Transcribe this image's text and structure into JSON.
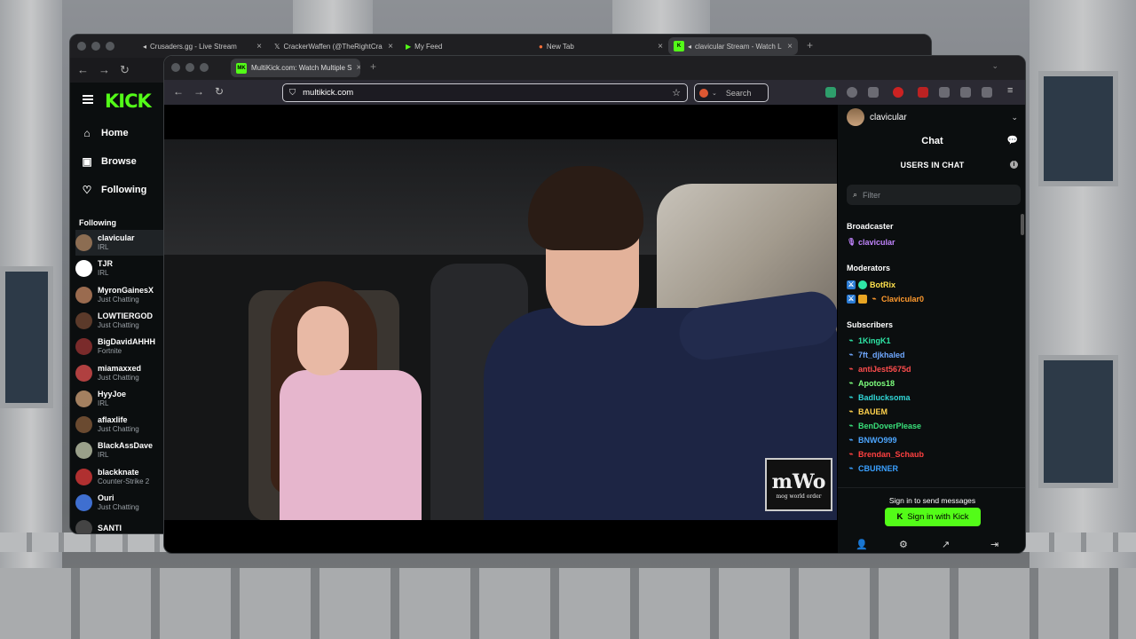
{
  "back_window": {
    "tabs": [
      {
        "label": "Crusaders.gg - Live Stream",
        "icon": "speaker-icon"
      },
      {
        "label": "CrackerWaffen (@TheRightCra",
        "icon": "x-logo-icon"
      },
      {
        "label": "My Feed",
        "icon": "play-icon"
      },
      {
        "label": "New Tab",
        "icon": "firefox-icon"
      },
      {
        "label": "clavicular Stream - Watch L",
        "icon": "kick-icon"
      }
    ],
    "kick": {
      "logo": "KICK",
      "nav": [
        {
          "label": "Home",
          "icon": "home-icon"
        },
        {
          "label": "Browse",
          "icon": "browse-icon"
        },
        {
          "label": "Following",
          "icon": "heart-icon"
        }
      ],
      "following_heading": "Following",
      "following": [
        {
          "name": "clavicular",
          "category": "IRL",
          "color": "#8c6d52"
        },
        {
          "name": "TJR",
          "category": "IRL",
          "color": "#ffffff"
        },
        {
          "name": "MyronGainesX",
          "category": "Just Chatting",
          "color": "#9a6b4f"
        },
        {
          "name": "LOWTIERGOD",
          "category": "Just Chatting",
          "color": "#5b3a2a"
        },
        {
          "name": "BigDavidAHHH",
          "category": "Fortnite",
          "color": "#7a2b2b"
        },
        {
          "name": "miamaxxed",
          "category": "Just Chatting",
          "color": "#b04040"
        },
        {
          "name": "HyyJoe",
          "category": "IRL",
          "color": "#a38060"
        },
        {
          "name": "aflaxlife",
          "category": "Just Chatting",
          "color": "#6a4a30"
        },
        {
          "name": "BlackAssDave",
          "category": "IRL",
          "color": "#9aa08a"
        },
        {
          "name": "blackknate",
          "category": "Counter-Strike 2",
          "color": "#b03030"
        },
        {
          "name": "Ouri",
          "category": "Just Chatting",
          "color": "#3f6fd0"
        },
        {
          "name": "SANTI",
          "category": "",
          "color": "#444444"
        }
      ]
    }
  },
  "front_window": {
    "tab_title": "MultiKick.com: Watch Multiple S",
    "tab_favicon": "MK",
    "url": "multikick.com",
    "search_placeholder": "Search",
    "video_logo": "mWo",
    "video_logo_sub": "mog world order",
    "chat": {
      "channel": "clavicular",
      "header": "Chat",
      "users_heading": "USERS IN CHAT",
      "filter_placeholder": "Filter",
      "broadcaster_heading": "Broadcaster",
      "broadcaster": {
        "name": "clavicular",
        "color": "#c084fc"
      },
      "moderators_heading": "Moderators",
      "moderators": [
        {
          "name": "BotRix",
          "color": "#ffe14d"
        },
        {
          "name": "Clavicular0",
          "color": "#ff9a2e"
        }
      ],
      "subscribers_heading": "Subscribers",
      "subscribers": [
        {
          "name": "1KingK1",
          "color": "#2ee6a6"
        },
        {
          "name": "7ft_djkhaled",
          "color": "#6fa8ff"
        },
        {
          "name": "antiJest5675d",
          "color": "#ff4d4d"
        },
        {
          "name": "Apotos18",
          "color": "#7dff7d"
        },
        {
          "name": "Badlucksoma",
          "color": "#31d7d7"
        },
        {
          "name": "BAUEM",
          "color": "#ffd24d"
        },
        {
          "name": "BenDoverPlease",
          "color": "#39e07a"
        },
        {
          "name": "BNWO999",
          "color": "#4da6ff"
        },
        {
          "name": "Brendan_Schaub",
          "color": "#ff4040"
        },
        {
          "name": "CBURNER",
          "color": "#3aa0ff"
        }
      ],
      "signin_prompt": "Sign in to send messages",
      "signin_button": "Sign in with Kick"
    }
  },
  "colors": {
    "kick_green": "#53fc18",
    "panel_bg": "#0b0e0f"
  }
}
